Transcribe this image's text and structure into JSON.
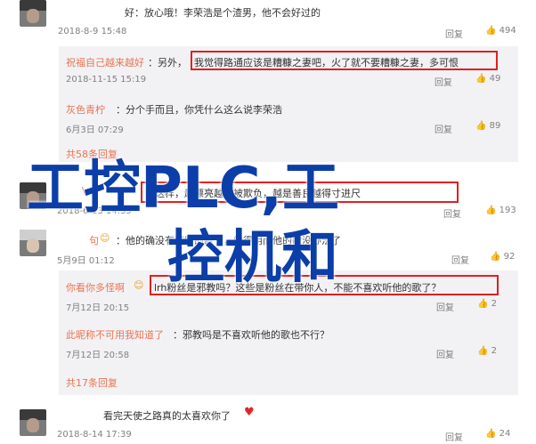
{
  "top": {
    "tail_text": "好：放心哦！李荣浩是个渣男，他不会好过的",
    "date": "2018-8-9 15:48",
    "reply": "回复",
    "likes": "494"
  },
  "replies": [
    {
      "name": "祝福自己越来越好",
      "text_pre": "：另外，",
      "text_box": "我觉得路通应该是糟糠之妻吧，火了就不要糟糠之妻，多可恨",
      "date": "2018-11-15 15:19",
      "reply": "回复",
      "likes": "49"
    },
    {
      "name": "灰色青柠",
      "text": "：分个手而且，你凭什么这么说李荣浩",
      "date": "6月3日 07:29",
      "reply": "回复",
      "likes": "89"
    }
  ],
  "more_replies_1": "共58条回复",
  "mid": {
    "name": "\\ !",
    "text_box": "说这样，越漂亮越是被欺负，越是善良越得寸进尺",
    "date": "2018-6-13 14:35",
    "reply": "回复",
    "likes": "193"
  },
  "second": {
    "name": "句",
    "text": "：他的确没有好听的歌了，觉得用而他的歌没办法了",
    "date": "5月9日 01:12",
    "reply": "回复",
    "likes": "92"
  },
  "replies2": [
    {
      "name": "你看你多怪啊",
      "text_box": "lrh粉丝是邪教吗？这些是粉丝在带你人，不能不喜欢听他的歌了？",
      "date": "7月12日 20:15",
      "reply": "回复",
      "likes": "2"
    },
    {
      "name": "此昵称不可用我知道了",
      "text": "：邪教吗是不喜欢听他的歌也不行？",
      "date": "7月12日 20:58",
      "reply": "回复",
      "likes": "2"
    }
  ],
  "more_replies_2": "共17条回复",
  "bottom": {
    "text": "看完天使之路真的太喜欢你了",
    "date": "2018-8-14 17:39",
    "reply": "回复",
    "likes": "24"
  },
  "overlay": {
    "line1": "工控PLC,工",
    "line2": "控机和"
  },
  "colors": {
    "name": "#eb7350",
    "highlight": "#e02020",
    "overlay": "#0b3ea8",
    "reply_bg": "#f2f2f5"
  }
}
